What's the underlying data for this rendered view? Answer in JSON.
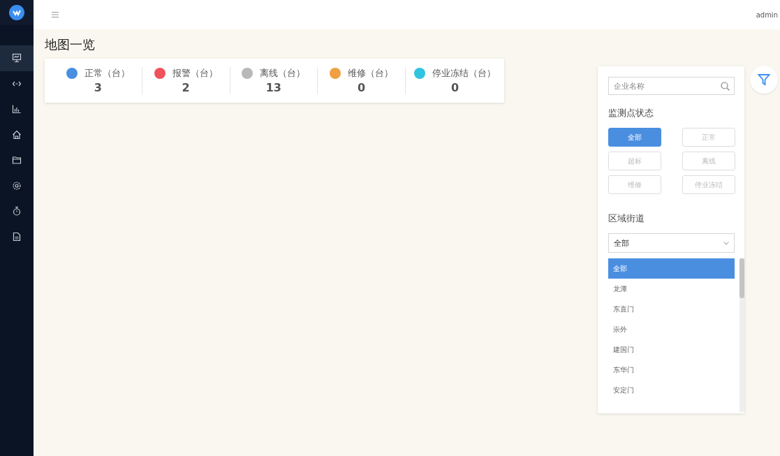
{
  "header": {
    "user": "admin"
  },
  "sidebar": {
    "items": [
      {
        "selected": true
      },
      {
        "selected": false
      },
      {
        "selected": false
      },
      {
        "selected": false
      },
      {
        "selected": false
      },
      {
        "selected": false
      },
      {
        "selected": false
      },
      {
        "selected": false
      }
    ]
  },
  "page_title": "地图一览",
  "stats": [
    {
      "label": "正常（台）",
      "value": "3",
      "color": "#4a8ee0"
    },
    {
      "label": "报警（台）",
      "value": "2",
      "color": "#f0525a"
    },
    {
      "label": "离线（台）",
      "value": "13",
      "color": "#b8b8b8"
    },
    {
      "label": "维修（台）",
      "value": "0",
      "color": "#f0a040"
    },
    {
      "label": "停业冻结（台）",
      "value": "0",
      "color": "#30c4e0"
    }
  ],
  "filter": {
    "search": {
      "placeholder": "企业名称"
    },
    "status_title": "监测点状态",
    "status_options": [
      {
        "label": "全部",
        "selected": true
      },
      {
        "label": "正常",
        "selected": false
      },
      {
        "label": "超标",
        "selected": false
      },
      {
        "label": "离线",
        "selected": false
      },
      {
        "label": "维修",
        "selected": false
      },
      {
        "label": "停业冻结",
        "selected": false
      }
    ],
    "region_title": "区域街道",
    "region_select": {
      "value": "全部"
    },
    "region_options": [
      {
        "label": "全部",
        "selected": true
      },
      {
        "label": "龙潭",
        "selected": false
      },
      {
        "label": "东直门",
        "selected": false
      },
      {
        "label": "崇外",
        "selected": false
      },
      {
        "label": "建国门",
        "selected": false
      },
      {
        "label": "东华门",
        "selected": false
      },
      {
        "label": "安定门",
        "selected": false
      }
    ]
  }
}
